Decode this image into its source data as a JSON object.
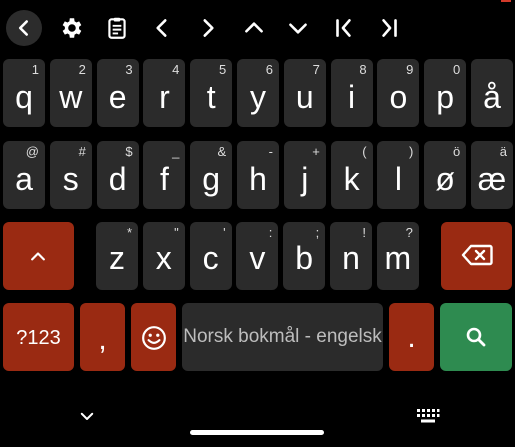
{
  "toolbar": {
    "icons": [
      "back-circle-icon",
      "gear-icon",
      "clipboard-icon",
      "chevron-left-icon",
      "chevron-right-icon",
      "chevron-up-icon",
      "chevron-down-icon",
      "line-start-icon",
      "line-end-icon"
    ]
  },
  "rows": {
    "r1": [
      {
        "main": "q",
        "hint": "1"
      },
      {
        "main": "w",
        "hint": "2"
      },
      {
        "main": "e",
        "hint": "3"
      },
      {
        "main": "r",
        "hint": "4"
      },
      {
        "main": "t",
        "hint": "5"
      },
      {
        "main": "y",
        "hint": "6"
      },
      {
        "main": "u",
        "hint": "7"
      },
      {
        "main": "i",
        "hint": "8"
      },
      {
        "main": "o",
        "hint": "9"
      },
      {
        "main": "p",
        "hint": "0"
      },
      {
        "main": "å",
        "hint": ""
      }
    ],
    "r2": [
      {
        "main": "a",
        "hint": "@"
      },
      {
        "main": "s",
        "hint": "#"
      },
      {
        "main": "d",
        "hint": "$"
      },
      {
        "main": "f",
        "hint": "_"
      },
      {
        "main": "g",
        "hint": "&"
      },
      {
        "main": "h",
        "hint": "-"
      },
      {
        "main": "j",
        "hint": "+"
      },
      {
        "main": "k",
        "hint": "("
      },
      {
        "main": "l",
        "hint": ")"
      },
      {
        "main": "ø",
        "hint": "ö"
      },
      {
        "main": "æ",
        "hint": "ä"
      }
    ],
    "r3": [
      {
        "main": "z",
        "hint": "*"
      },
      {
        "main": "x",
        "hint": "\""
      },
      {
        "main": "c",
        "hint": "'"
      },
      {
        "main": "v",
        "hint": ":"
      },
      {
        "main": "b",
        "hint": ";"
      },
      {
        "main": "n",
        "hint": "!"
      },
      {
        "main": "m",
        "hint": "?"
      }
    ]
  },
  "bottom": {
    "symbols_label": "?123",
    "comma_label": ",",
    "space_label": "Norsk bokmål - engelsk",
    "period_label": "."
  },
  "colors": {
    "accent": "#9a2a12",
    "action": "#2e8b50",
    "key": "#2b2b2b"
  }
}
